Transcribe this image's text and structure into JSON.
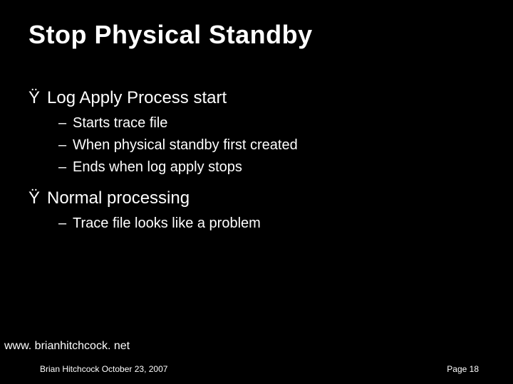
{
  "slide": {
    "title": "Stop Physical Standby",
    "bullets": [
      {
        "marker": "Ÿ",
        "text": "Log Apply Process start",
        "children": [
          {
            "marker": "–",
            "text": "Starts trace file"
          },
          {
            "marker": "–",
            "text": "When physical standby first created"
          },
          {
            "marker": "–",
            "text": "Ends when log apply stops"
          }
        ]
      },
      {
        "marker": "Ÿ",
        "text": "Normal processing",
        "children": [
          {
            "marker": "–",
            "text": "Trace file looks like a problem"
          }
        ]
      }
    ]
  },
  "footer": {
    "url": "www. brianhitchcock. net",
    "author_date": "Brian Hitchcock   October 23, 2007",
    "page": "Page 18"
  }
}
